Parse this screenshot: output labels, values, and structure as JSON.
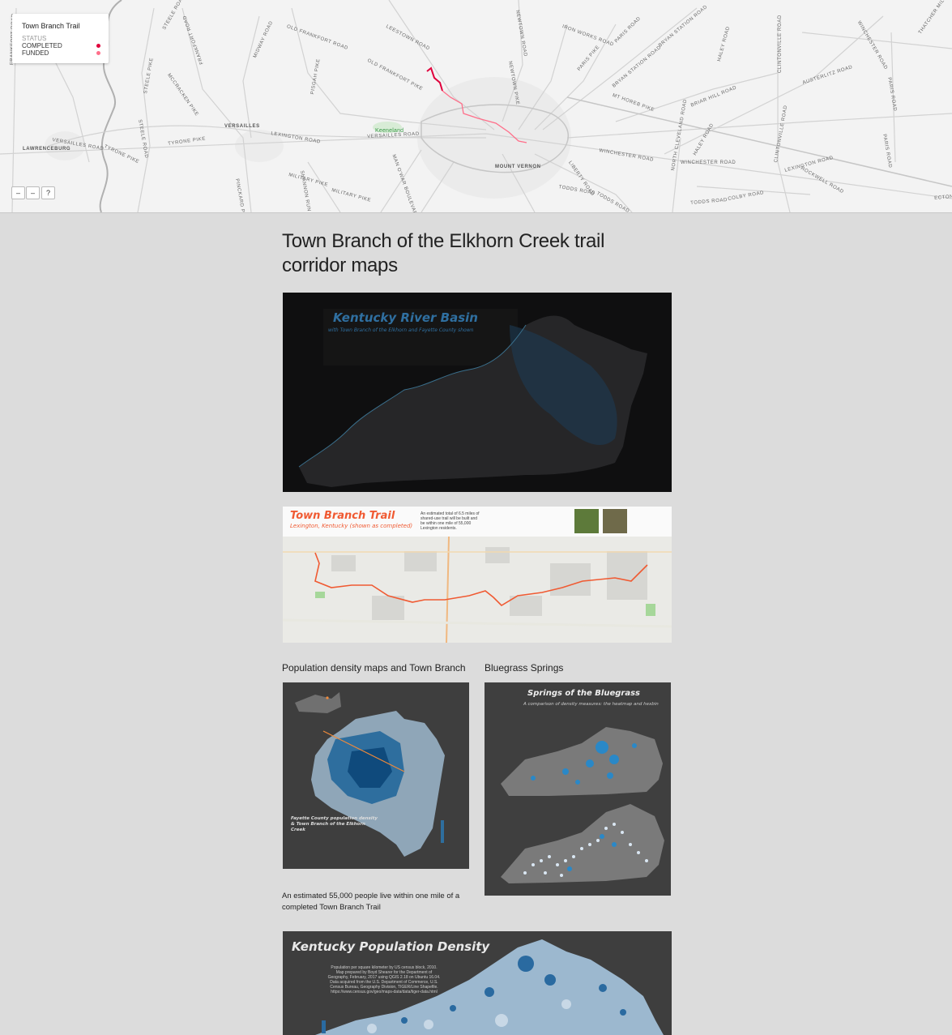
{
  "map": {
    "legend": {
      "title": "Town Branch Trail",
      "status_label": "STATUS",
      "completed_label": "COMPLETED",
      "funded_label": "FUNDED",
      "completed_color": "#e0003c",
      "funded_color": "#ff6f8a"
    },
    "controls": {
      "zoom_in": "–",
      "zoom_out": "–",
      "help": "?"
    },
    "places": {
      "lawrenceburg": "LAWRENCEBURG",
      "versailles": "VERSAILLES",
      "keeneland": "Keeneland",
      "mount_vernon": "MOUNT VERNON"
    },
    "roads": {
      "steele": "STEELE ROAD",
      "frankfort_road": "FRANKFORT ROAD",
      "midway": "MIDWAY ROAD",
      "old_frankfort": "OLD FRANKFORT ROAD",
      "leestown": "LEESTOWN ROAD",
      "newtown": "NEWTOWN ROAD",
      "iron_works": "IRON WORKS ROAD",
      "paris_road": "PARIS ROAD",
      "bryan_station": "BRYAN STATION ROAD",
      "winchester_top": "WINCHESTER ROAD",
      "thatcher": "THATCHER MILL",
      "mccracken": "MCCRACKEN PIKE",
      "pisgah": "PISGAH PIKE",
      "old_frankfort_pike": "OLD FRANKFORT PIKE",
      "newtown_pike": "NEWTOWN PIKE",
      "paris_pike": "PARIS PIKE",
      "bryan_station_road": "BRYAN STATION ROAD",
      "mt_horeb": "MT HOREB PIKE",
      "briar_hill": "BRIAR HILL ROAD",
      "clintonville": "CLINTONVILLE ROAD",
      "austerlitz": "AUSTERLITZ ROAD",
      "paris_road2": "PARIS ROAD",
      "versailles_road": "VERSAILLES ROAD",
      "tyrone": "TYRONE PIKE",
      "steele_road2": "STEELE ROAD",
      "lexington_road": "LEXINGTON ROAD",
      "versailles_road2": "VERSAILLES ROAD",
      "man_o_war": "MAN O'WAR BOULEVARD",
      "winchester_road": "WINCHESTER ROAD",
      "haley": "HALEY ROAD",
      "winchester_road2": "WINCHESTER ROAD",
      "clintonville2": "CLINTONVILLE ROAD",
      "rockwell": "ROCKWELL ROAD",
      "lexington_road2": "LEXINGTON ROAD",
      "paris_road3": "PARIS ROAD",
      "military": "MILITARY PIKE",
      "shannon_run": "SHANNON RUN ROAD",
      "military2": "MILITARY PIKE",
      "todds": "TODDS ROAD",
      "todds2": "TODDS ROAD",
      "n_cleveland": "NORTH CLEVELAND ROAD",
      "liberty": "LIBERTY ROAD",
      "colby": "COLBY ROAD",
      "pinckard": "PINCKARD PIKE",
      "old_frankfort_pike2": "OLD FRANKFORT PIKE",
      "todds3": "TODDS ROAD",
      "ecton": "ECTON",
      "frankfort_road2": "FRANKFORT ROAD",
      "mccracken2": "MCCRACKEN PIKE",
      "steele3": "STEELE PIKE",
      "pisgah2": "PISGAH PIKE"
    }
  },
  "page": {
    "title": "Town Branch of the Elkhorn Creek trail corridor maps"
  },
  "images": {
    "basin": {
      "title": "Kentucky River Basin",
      "subtitle": "with Town Branch of the Elkhorn and Fayette County shown"
    },
    "trail": {
      "title": "Town Branch Trail",
      "subtitle": "Lexington, Kentucky (shown as completed)",
      "blurb": "An estimated total of 6.5 miles of shared-use trail will be built and be within one mile of 55,000 Lexington residents."
    },
    "fayette": {
      "map_title": "Fayette County population density & Town Branch of the Elkhorn Creek"
    },
    "springs": {
      "title": "Springs of the Bluegrass",
      "subtitle": "A comparison of density measures: the heatmap and hexbin"
    },
    "density": {
      "title": "Kentucky Population Density",
      "credits": "Population per square kilometer by US census block, 2010. Map prepared by Boyd Shearer for the Department of Geography, February, 2017 using QGIS 2.18 on Ubuntu 16.04. Data acquired from the U.S. Department of Commerce, U.S. Census Bureau, Geography Division, TIGER/Line Shapefile. https://www.census.gov/geo/maps-data/data/tiger-data.html"
    }
  },
  "captions": {
    "population": "Population density maps and Town Branch",
    "springs": "Bluegrass Springs",
    "population_note": "An estimated 55,000 people live within one mile of a completed Town Branch Trail"
  }
}
